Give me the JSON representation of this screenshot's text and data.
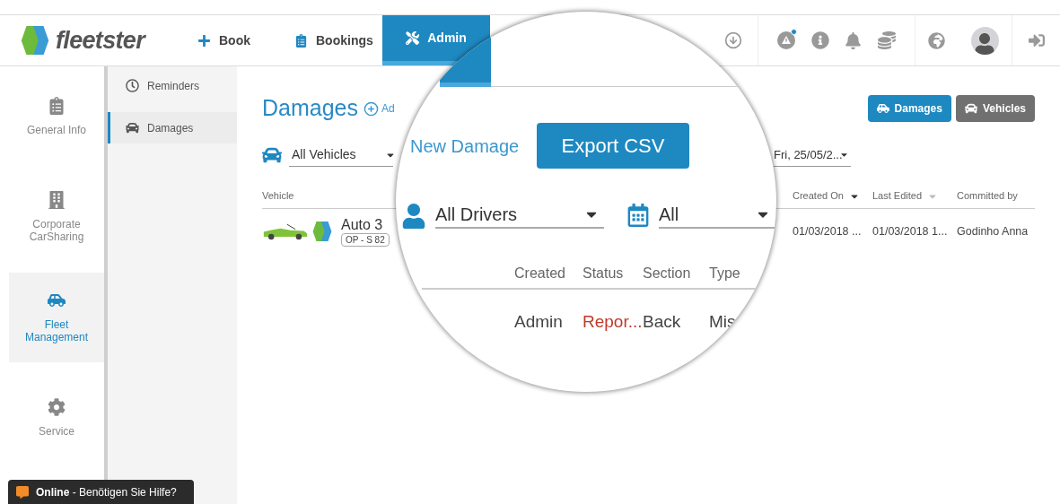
{
  "header": {
    "logo": "fleetster",
    "nav": [
      {
        "label": "Book",
        "selected": false
      },
      {
        "label": "Bookings",
        "selected": false
      },
      {
        "label": "Admin",
        "selected": true
      }
    ],
    "alerts_badge": true
  },
  "sidebar": {
    "items": [
      {
        "label": "General Info",
        "selected": false
      },
      {
        "label": "Corporate CarSharing",
        "selected": false
      },
      {
        "label": "Fleet Management",
        "selected": true
      },
      {
        "label": "Service",
        "selected": false
      }
    ]
  },
  "subnav": {
    "items": [
      {
        "label": "Reminders",
        "selected": false
      },
      {
        "label": "Damages",
        "selected": true
      }
    ]
  },
  "page": {
    "title": "Damages",
    "add_link": "Ad",
    "views": [
      {
        "label": "Damages",
        "selected": true
      },
      {
        "label": "Vehicles",
        "selected": false
      }
    ],
    "vehicle_filter": "All Vehicles",
    "date_filter": "Fri, 25/05/2...",
    "table": {
      "columns": [
        {
          "label": "Vehicle"
        },
        {
          "label": "Created On",
          "sorted": true
        },
        {
          "label": "Last Edited",
          "sorted": false
        },
        {
          "label": "Committed by"
        }
      ],
      "rows": [
        {
          "vehicle": "Auto 3",
          "plate": "OP - S 82",
          "created_on": "01/03/2018 ...",
          "last_edited": "01/03/2018 1...",
          "committed_by": "Godinho Anna"
        }
      ]
    }
  },
  "magnifier": {
    "link": "New Damage",
    "button": "Export CSV",
    "driver_filter": "All Drivers",
    "period_filter": "All",
    "columns": [
      "Created",
      "Status",
      "Section",
      "Type"
    ],
    "row": [
      "Admin",
      "Repor...",
      "Back",
      "Mis"
    ]
  },
  "chat": {
    "text": "**Online** - Benötigen Sie Hilfe?"
  }
}
